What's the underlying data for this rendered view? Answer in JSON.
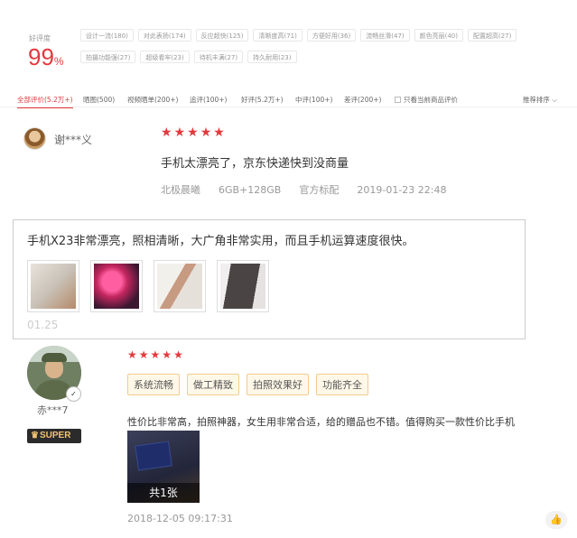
{
  "summary": {
    "rate_label": "好评度",
    "rate_value": "99",
    "rate_unit": "%",
    "tags": [
      "设计一流(180)",
      "对此表扬(174)",
      "反应超快(125)",
      "清晰度高(71)",
      "方便好用(36)",
      "流畅丝滑(47)",
      "颜色亮丽(40)",
      "配置超高(27)",
      "拍摄功能强(27)",
      "超级看牢(23)",
      "待机丰满(27)",
      "持久耐用(23)"
    ]
  },
  "filters": {
    "items": [
      {
        "label": "全部评价(5.2万+)",
        "active": true
      },
      {
        "label": "晒图(500)",
        "active": false
      },
      {
        "label": "视频晒单(200+)",
        "active": false
      },
      {
        "label": "追评(100+)",
        "active": false
      },
      {
        "label": "好评(5.2万+)",
        "active": false
      },
      {
        "label": "中评(100+)",
        "active": false
      },
      {
        "label": "差评(200+)",
        "active": false
      }
    ],
    "current_only": "只看当前商品评价",
    "sort_label": "推荐排序"
  },
  "review1": {
    "username": "谢***义",
    "stars": 5,
    "text": "手机太漂亮了，京东快递快到没商量",
    "color": "北极晨曦",
    "spec": "6GB+128GB",
    "config": "官方标配",
    "datetime": "2019-01-23 22:48",
    "followup_text": "手机X23非常漂亮，照相清晰，大广角非常实用，而且手机运算速度很快。",
    "followup_date": "01.25"
  },
  "review2": {
    "username": "赤***7",
    "badge": "SUPER",
    "stars": 5,
    "tags": [
      "系统流畅",
      "做工精致",
      "拍照效果好",
      "功能齐全"
    ],
    "text": "性价比非常高，拍照神器，女生用非常合适，给的赠品也不错。值得购买一款性价比手机",
    "photo_count": "共1张",
    "datetime": "2018-12-05 09:17:31"
  },
  "colors": {
    "accent": "#e4393c",
    "tag_bg": "#fff8e8",
    "tag_border": "#f2cc8c"
  },
  "icons": [
    "star-icon",
    "chevron-down-icon",
    "like-icon",
    "crown-icon",
    "checkbox-icon"
  ]
}
